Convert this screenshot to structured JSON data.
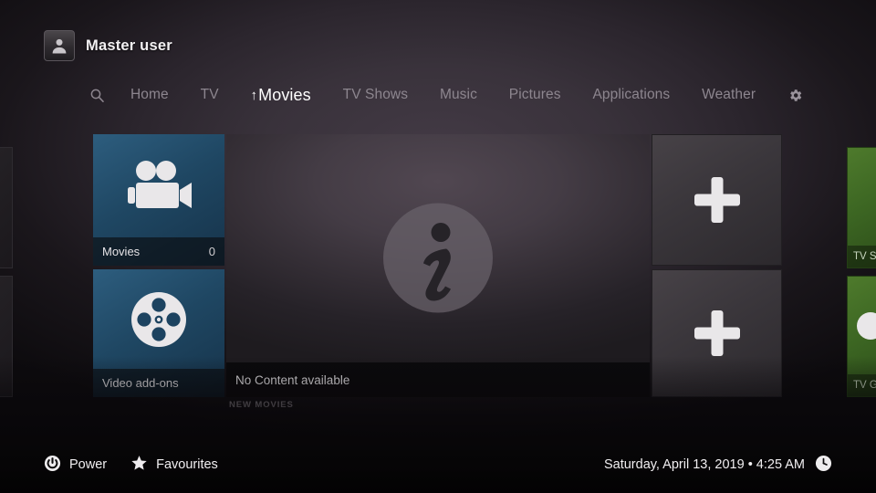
{
  "user": {
    "name": "Master user",
    "avatar_icon": "user-avatar-icon"
  },
  "nav": {
    "search_icon": "search-icon",
    "settings_icon": "gear-icon",
    "active_prefix": "↑",
    "items": [
      {
        "label": "Home",
        "active": false
      },
      {
        "label": "TV",
        "active": false
      },
      {
        "label": "Movies",
        "active": true
      },
      {
        "label": "TV Shows",
        "active": false
      },
      {
        "label": "Music",
        "active": false
      },
      {
        "label": "Pictures",
        "active": false
      },
      {
        "label": "Applications",
        "active": false
      },
      {
        "label": "Weather",
        "active": false
      }
    ]
  },
  "grid": {
    "edge_left_top": {
      "label": ""
    },
    "edge_left_bottom": {
      "label": ""
    },
    "movies_tile": {
      "label": "Movies",
      "count": "0",
      "icon": "movie-camera-icon",
      "color": "#1f4763"
    },
    "video_addons_tile": {
      "label": "Video add-ons",
      "count": "",
      "icon": "film-reel-icon",
      "color": "#1f4763"
    },
    "info_panel": {
      "icon": "info-circle-icon",
      "status_text": "No Content available"
    },
    "new_movies_label": "NEW MOVIES",
    "plus_tile_top": {
      "icon": "plus-icon"
    },
    "plus_tile_bottom": {
      "icon": "plus-icon"
    },
    "edge_right_top": {
      "label": "TV S",
      "color": "#3d6723"
    },
    "edge_right_bottom": {
      "label": "TV G",
      "color": "#3d6723"
    }
  },
  "bottombar": {
    "power": {
      "label": "Power",
      "icon": "power-icon"
    },
    "favourites": {
      "label": "Favourites",
      "icon": "star-icon"
    },
    "datetime": "Saturday, April 13, 2019 • 4:25 AM",
    "clock_icon": "clock-icon"
  },
  "colors": {
    "background": "#39323b",
    "tile_blue": "#1f4763",
    "tile_green": "#3d6723",
    "tile_gray": "#3b373c",
    "text_primary": "#ffffff",
    "text_muted": "#8d868f"
  }
}
